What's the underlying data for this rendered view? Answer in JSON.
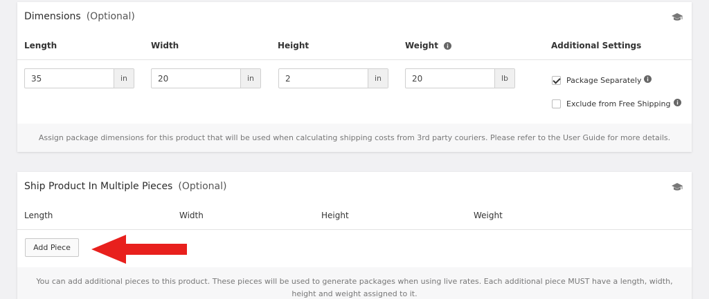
{
  "dimensions": {
    "title": "Dimensions",
    "optional": "(Optional)",
    "columns": {
      "length": "Length",
      "width": "Width",
      "height": "Height",
      "weight": "Weight",
      "additional": "Additional Settings"
    },
    "fields": {
      "length": {
        "value": "35",
        "unit": "in"
      },
      "width": {
        "value": "20",
        "unit": "in"
      },
      "height": {
        "value": "2",
        "unit": "in"
      },
      "weight": {
        "value": "20",
        "unit": "lb"
      }
    },
    "package_separately": {
      "label": "Package Separately",
      "checked": true
    },
    "exclude_free_shipping": {
      "label": "Exclude from Free Shipping",
      "checked": false
    },
    "footer": "Assign package dimensions for this product that will be used when calculating shipping costs from 3rd party couriers. Please refer to the User Guide for more details."
  },
  "pieces": {
    "title": "Ship Product In Multiple Pieces",
    "optional": "(Optional)",
    "columns": {
      "length": "Length",
      "width": "Width",
      "height": "Height",
      "weight": "Weight"
    },
    "add_button": "Add Piece",
    "footer": "You can add additional pieces to this product. These pieces will be used to generate packages when using live rates. Each additional piece MUST have a length, width, height and weight assigned to it."
  },
  "colors": {
    "arrow": "#e8201d",
    "icon": "#777777"
  }
}
